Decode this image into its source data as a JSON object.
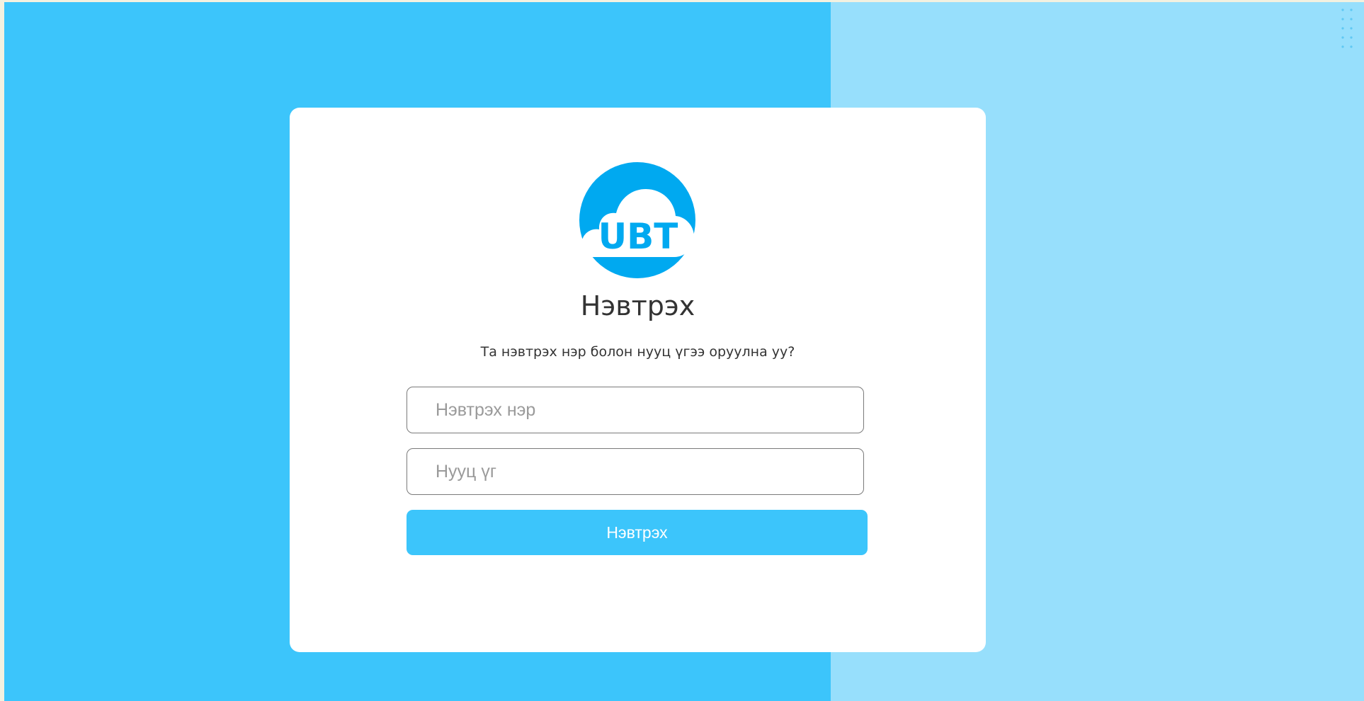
{
  "theme": {
    "primary": "#3cc5fb",
    "secondary": "#97dffc",
    "card": "#ffffff"
  },
  "logo": {
    "text": "UBT",
    "icon": "cloud-logo-icon"
  },
  "login": {
    "title": "Нэвтрэх",
    "subtitle": "Та нэвтрэх нэр болон нууц үгээ оруулна уу?",
    "username_placeholder": "Нэвтрэх нэр",
    "password_placeholder": "Нууц үг",
    "submit_label": "Нэвтрэх"
  }
}
